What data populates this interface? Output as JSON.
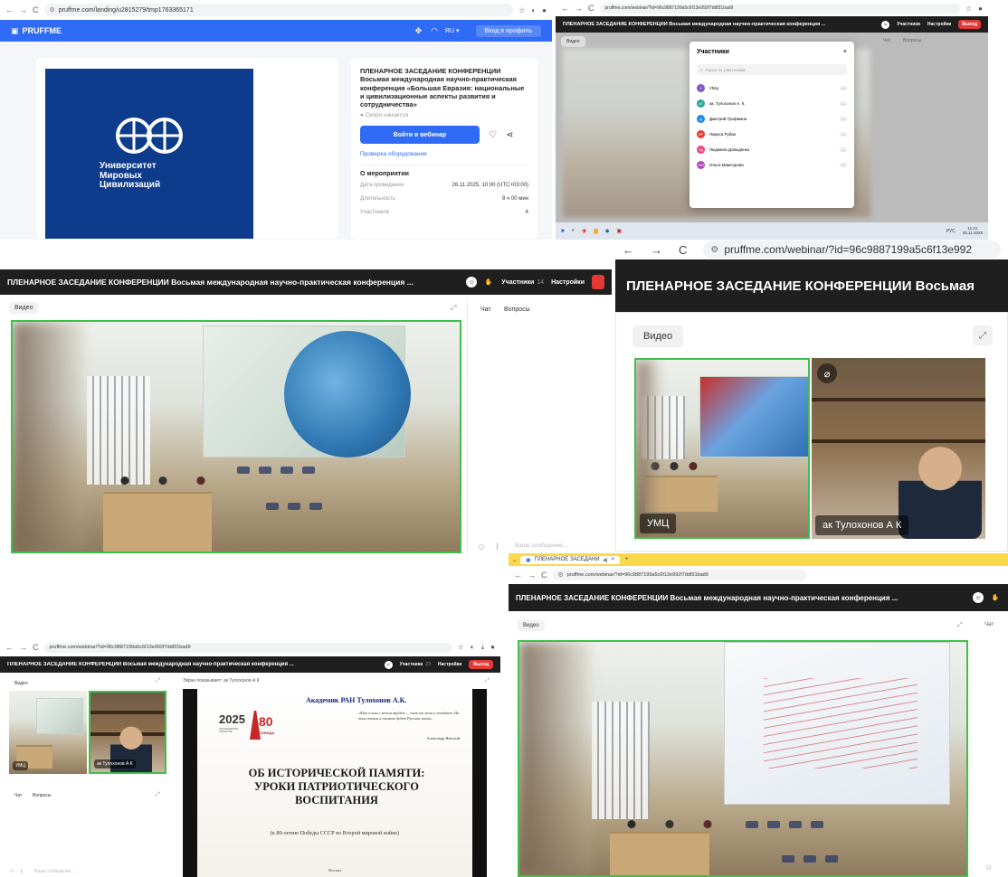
{
  "landing": {
    "url": "pruffme.com/landing/u2815279/tmp1763365171",
    "brand": "PRUFFME",
    "lang": "RU ▾",
    "login": "Вход в профиль",
    "org_name": "Университет Мировых Цивилизаций",
    "title": "ПЛЕНАРНОЕ ЗАСЕДАНИЕ КОНФЕРЕНЦИИ Восьмая международная научно-практическая конференция «Большая Евразия: национальные и цивилизационные аспекты развития и сотрудничества»",
    "status": "● Скоро начнется",
    "join": "Войти в вебинар",
    "check": "Проверка оборудования",
    "about": "О мероприятии",
    "rows": [
      {
        "k": "Дата проведения",
        "v": "26.11.2025, 10:00 (UTC+03:00)"
      },
      {
        "k": "Длительность",
        "v": "8 ч 00 мин"
      },
      {
        "k": "Участников",
        "v": "4"
      }
    ]
  },
  "participants": {
    "url": "pruffme.com/webinar/?id=96c9887199a5c6f13e992f7ddf31bad9",
    "header": "ПЛЕНАРНОЕ ЗАСЕДАНИЕ КОНФЕРЕНЦИИ Восьмая международная научно-практическая конференция ...",
    "hdr_participants": "Участники",
    "hdr_settings": "Настройки",
    "hdr_exit": "Выход",
    "video": "Видео",
    "chat": "Чат",
    "questions": "Вопросы",
    "modal_title": "Участники",
    "search": "Поиск по участникам",
    "list": [
      {
        "initials": "У",
        "name": "УМЦ",
        "color": "#7e57c2"
      },
      {
        "initials": "АТ",
        "name": "ак. Тулохонов А. К.",
        "color": "#26a69a"
      },
      {
        "initials": "Д",
        "name": "Дмитрий Трофимов",
        "color": "#1e88e5"
      },
      {
        "initials": "ЛР",
        "name": "Лариса Рубан",
        "color": "#e53935"
      },
      {
        "initials": "ЛД",
        "name": "Людмила Довыденко",
        "color": "#ec407a"
      },
      {
        "initials": "ОМ",
        "name": "Ольга Мамчорова",
        "color": "#ab47bc"
      }
    ],
    "taskbar_time": "11:41",
    "taskbar_date": "26.11.2025",
    "taskbar_lang": "РУС"
  },
  "zoom_url": {
    "url": "pruffme.com/webinar/?id=96c9887199a5c6f13e992",
    "header": "ПЛЕНАРНОЕ ЗАСЕДАНИЕ КОНФЕРЕНЦИИ Восьмая",
    "video": "Видео",
    "tile1": "УМЦ",
    "tile2": "ак Тулохонов А К"
  },
  "hall": {
    "header": "ПЛЕНАРНОЕ ЗАСЕДАНИЕ КОНФЕРЕНЦИИ Восьмая международная научно-практическая конференция ...",
    "participants": "Участники",
    "count": "14",
    "settings": "Настройки",
    "video": "Видео",
    "chat": "Чат",
    "questions": "Вопросы",
    "placeholder": "Ваше сообщение..."
  },
  "slide": {
    "url": "pruffme.com/webinar/?id=96c9887199a5c6f13e992f7ddf31bad9",
    "header": "ПЛЕНАРНОЕ ЗАСЕДАНИЕ КОНФЕРЕНЦИИ Восьмая международная научно-практическая конференция ...",
    "participants": "Участники",
    "count": "23",
    "settings": "Настройки",
    "exit": "Выход",
    "video": "Видео",
    "tile1": "УМЦ",
    "tile2": "ак Тулохонов А К",
    "chat": "Чат",
    "questions": "Вопросы",
    "placeholder": "Ваше сообщение...",
    "share_label": "Экран показывает:",
    "share_name": "ак Тулохонов А К",
    "slide_author": "Академик РАН Тулохонов А.К.",
    "slide_year": "2025",
    "slide_year_sub": "ГОД ЗАЩИТНИКА ОТЕЧЕСТВА",
    "slide_80": "80",
    "slide_pobeda": "ПОБЕДА",
    "quote": "«Кто к нам с мечом придёт — тот от меча и погибнет. На том стояла и стоять будет Русская земля»",
    "quote_author": "Александр Невский",
    "headline": "ОБ ИСТОРИЧЕСКОЙ ПАМЯТИ: УРОКИ ПАТРИОТИЧЕСКОГО ВОСПИТАНИЯ",
    "subline": "(к 80-летию Победы СССР во Второй мировой войне)",
    "city": "Москва"
  },
  "tab": {
    "tab_label": "ПЛЕНАРНОЕ ЗАСЕДАНИ",
    "url": "pruffme.com/webinar/?id=96c9887199a5c6f13e992f7ddf31bad9",
    "header": "ПЛЕНАРНОЕ ЗАСЕДАНИЕ КОНФЕРЕНЦИИ Восьмая международная научно-практическая конференция ...",
    "video": "Видео",
    "chat": "Чат"
  },
  "colors": {
    "accent": "#2f6bf5",
    "live_green": "#3fbf4b",
    "exit_red": "#e53935"
  }
}
